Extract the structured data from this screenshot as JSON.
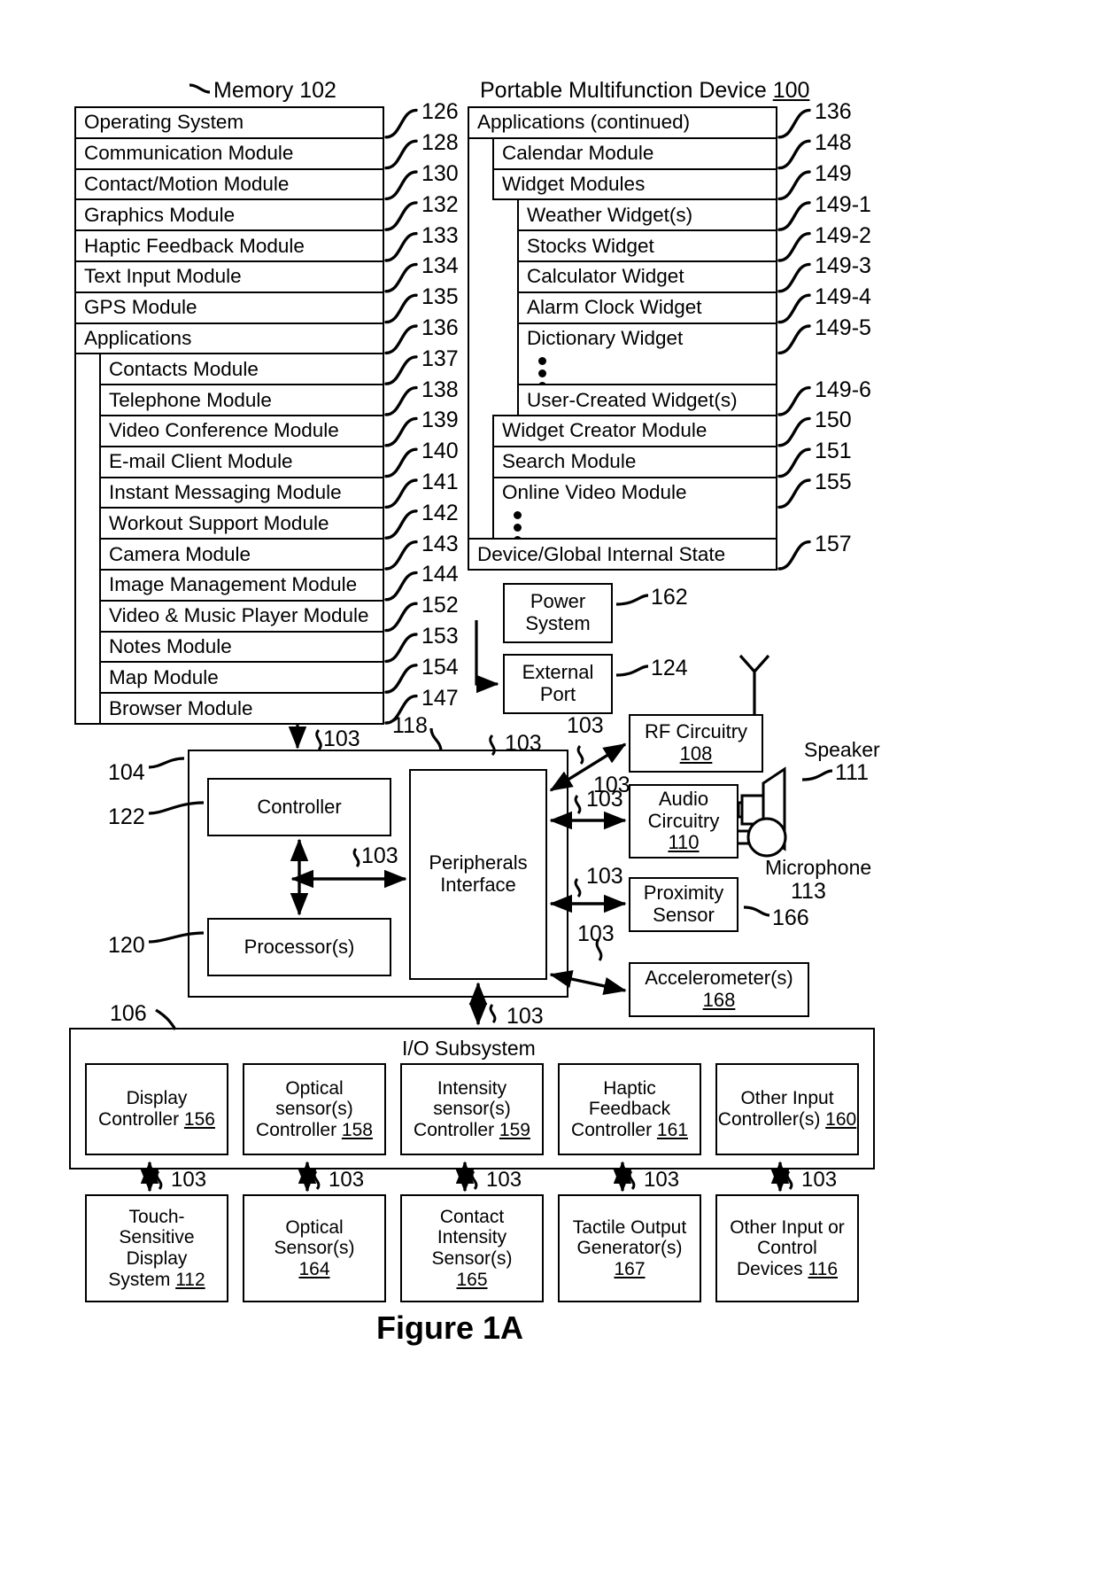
{
  "figure": {
    "caption": "Figure 1A"
  },
  "memory_stack": {
    "title": "Memory 102",
    "title_label": "Memory",
    "title_num": "102",
    "items": [
      {
        "label": "Operating System",
        "ref": "126",
        "indent": 0
      },
      {
        "label": "Communication Module",
        "ref": "128",
        "indent": 0
      },
      {
        "label": "Contact/Motion Module",
        "ref": "130",
        "indent": 0
      },
      {
        "label": "Graphics Module",
        "ref": "132",
        "indent": 0
      },
      {
        "label": "Haptic Feedback Module",
        "ref": "133",
        "indent": 0
      },
      {
        "label": "Text Input Module",
        "ref": "134",
        "indent": 0
      },
      {
        "label": "GPS Module",
        "ref": "135",
        "indent": 0
      },
      {
        "label": "Applications",
        "ref": "136",
        "indent": 0
      },
      {
        "label": "Contacts Module",
        "ref": "137",
        "indent": 1
      },
      {
        "label": "Telephone Module",
        "ref": "138",
        "indent": 1
      },
      {
        "label": "Video Conference Module",
        "ref": "139",
        "indent": 1
      },
      {
        "label": "E-mail Client Module",
        "ref": "140",
        "indent": 1
      },
      {
        "label": "Instant Messaging Module",
        "ref": "141",
        "indent": 1
      },
      {
        "label": "Workout Support Module",
        "ref": "142",
        "indent": 1
      },
      {
        "label": "Camera Module",
        "ref": "143",
        "indent": 1
      },
      {
        "label": "Image Management Module",
        "ref": "144",
        "indent": 1
      },
      {
        "label": "Video & Music Player Module",
        "ref": "152",
        "indent": 1
      },
      {
        "label": "Notes Module",
        "ref": "153",
        "indent": 1
      },
      {
        "label": "Map Module",
        "ref": "154",
        "indent": 1
      },
      {
        "label": "Browser Module",
        "ref": "147",
        "indent": 1
      }
    ]
  },
  "device_stack": {
    "title": "Portable Multifunction Device 100",
    "title_label": "Portable Multifunction Device",
    "title_num": "100",
    "items": [
      {
        "label": "Applications (continued)",
        "ref": "136",
        "indent": 0
      },
      {
        "label": "Calendar Module",
        "ref": "148",
        "indent": 1
      },
      {
        "label": "Widget Modules",
        "ref": "149",
        "indent": 1
      },
      {
        "label": "Weather Widget(s)",
        "ref": "149-1",
        "indent": 2
      },
      {
        "label": "Stocks Widget",
        "ref": "149-2",
        "indent": 2
      },
      {
        "label": "Calculator Widget",
        "ref": "149-3",
        "indent": 2
      },
      {
        "label": "Alarm Clock Widget",
        "ref": "149-4",
        "indent": 2
      },
      {
        "label": "Dictionary Widget",
        "ref": "149-5",
        "indent": 2
      },
      {
        "label": "",
        "ref": "",
        "indent": 2,
        "ellipsis": true
      },
      {
        "label": "User-Created Widget(s)",
        "ref": "149-6",
        "indent": 2
      },
      {
        "label": "Widget Creator Module",
        "ref": "150",
        "indent": 1
      },
      {
        "label": "Search Module",
        "ref": "151",
        "indent": 1
      },
      {
        "label": "Online Video Module",
        "ref": "155",
        "indent": 1
      },
      {
        "label": "",
        "ref": "",
        "indent": 1,
        "ellipsis": true
      },
      {
        "label": "Device/Global Internal State",
        "ref": "157",
        "indent": 0
      }
    ]
  },
  "blocks": {
    "power_system": {
      "line1": "Power",
      "line2": "System",
      "ref": "162"
    },
    "external_port": {
      "line1": "External",
      "line2": "Port",
      "ref": "124"
    },
    "rf_circuitry": {
      "line1": "RF Circuitry",
      "num": "108"
    },
    "audio_circuitry": {
      "line1": "Audio",
      "line2": "Circuitry",
      "num": "110"
    },
    "proximity_sensor": {
      "line1": "Proximity",
      "line2": "Sensor",
      "ref": "166"
    },
    "accelerometers": {
      "line1": "Accelerometer(s)",
      "num": "168"
    },
    "controller": {
      "label": "Controller",
      "ref": "122"
    },
    "processors": {
      "label": "Processor(s)",
      "ref": "120"
    },
    "peripherals_interface": {
      "line1": "Peripherals",
      "line2": "Interface",
      "ref": "118"
    },
    "outer_ref": "104",
    "speaker": {
      "label": "Speaker",
      "ref": "111"
    },
    "microphone": {
      "label": "Microphone",
      "ref": "113"
    }
  },
  "io_subsystem": {
    "title": "I/O Subsystem",
    "ref": "106",
    "controllers": [
      {
        "line1": "Display",
        "line2": "Controller",
        "num": "156"
      },
      {
        "line1": "Optical",
        "line2": "sensor(s)",
        "line3": "Controller",
        "num": "158"
      },
      {
        "line1": "Intensity",
        "line2": "sensor(s)",
        "line3": "Controller",
        "num": "159"
      },
      {
        "line1": "Haptic",
        "line2": "Feedback",
        "line3": "Controller",
        "num": "161"
      },
      {
        "line1": "Other Input",
        "line2": "Controller(s)",
        "num": "160"
      }
    ],
    "devices": [
      {
        "line1": "Touch-",
        "line2": "Sensitive",
        "line3": "Display",
        "line4": "System",
        "num": "112"
      },
      {
        "line1": "Optical",
        "line2": "Sensor(s)",
        "num": "164"
      },
      {
        "line1": "Contact",
        "line2": "Intensity",
        "line3": "Sensor(s)",
        "num": "165"
      },
      {
        "line1": "Tactile Output",
        "line2": "Generator(s)",
        "num": "167"
      },
      {
        "line1": "Other Input or",
        "line2": "Control",
        "line3": "Devices",
        "num": "116"
      }
    ],
    "bus_labels": [
      "103",
      "103",
      "103",
      "103",
      "103"
    ]
  },
  "bus_tags": {
    "t1": "103",
    "t2": "103",
    "t3": "103",
    "t4": "103",
    "t5": "103",
    "t6": "103",
    "t7": "103",
    "t8": "103",
    "t9": "103"
  }
}
